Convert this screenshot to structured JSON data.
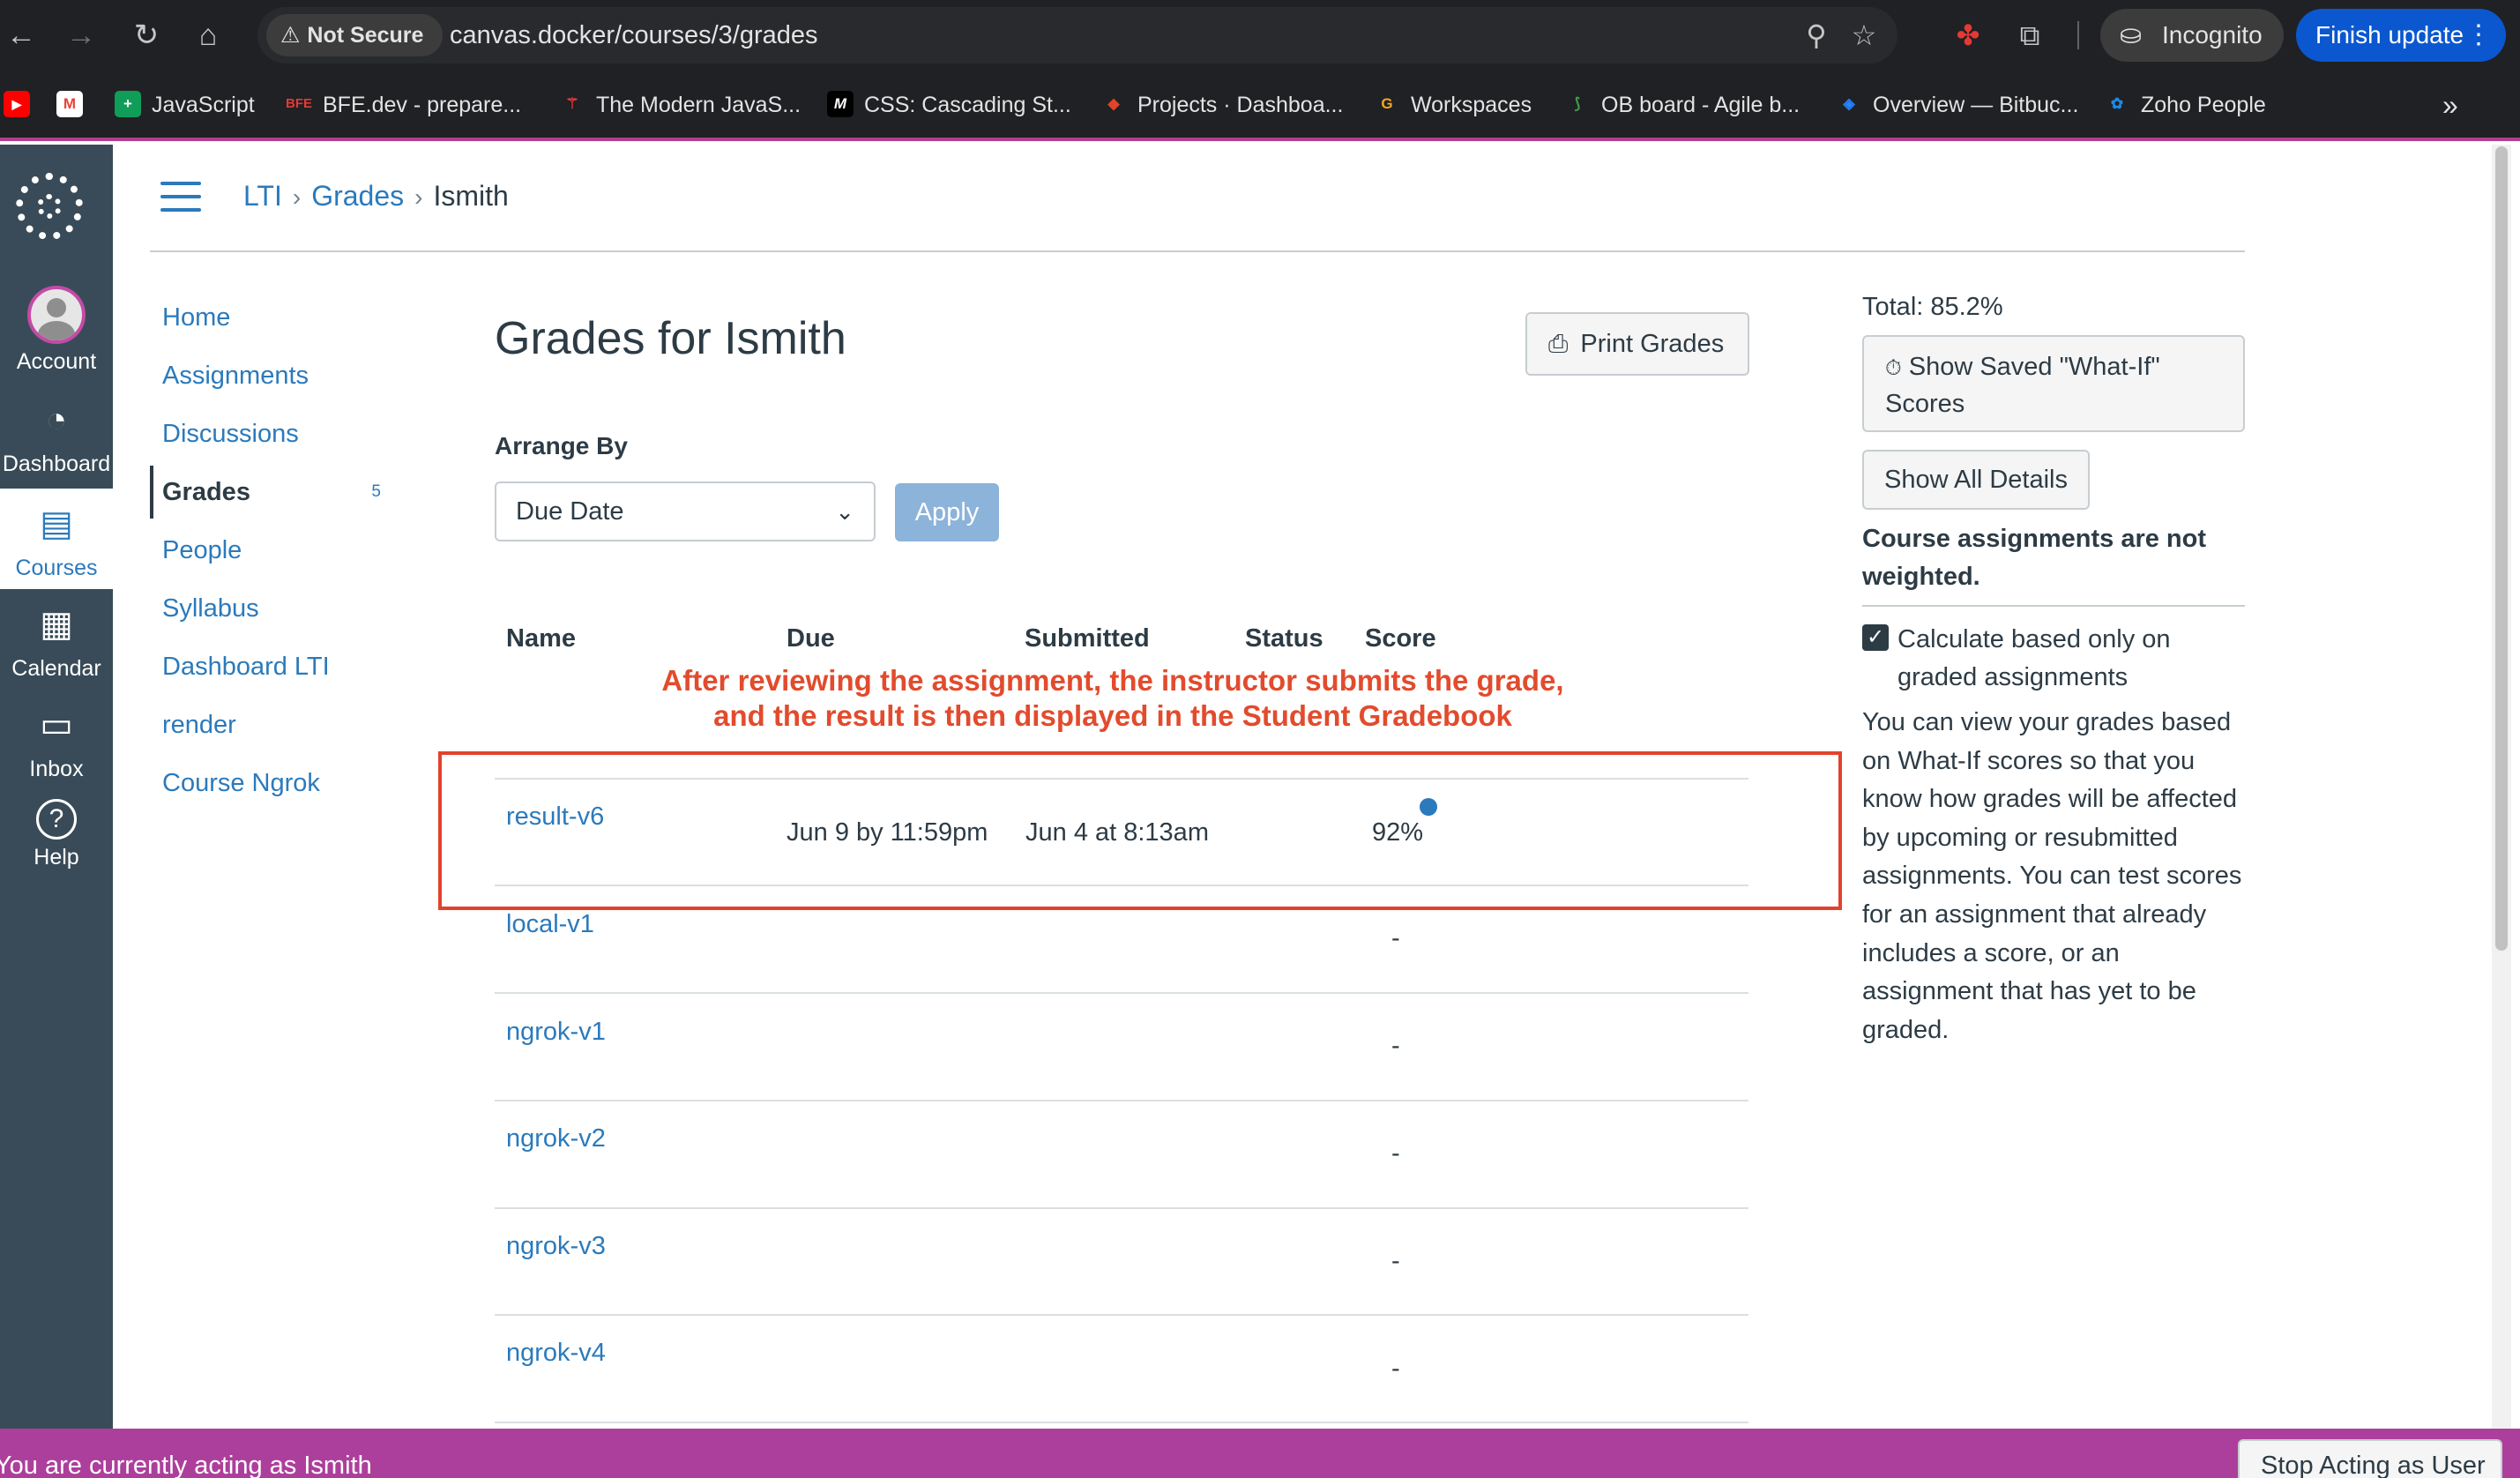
{
  "browser": {
    "security_label": "Not Secure",
    "url": "canvas.docker/courses/3/grades",
    "incognito_label": "Incognito",
    "update_label": "Finish update",
    "bookmarks": [
      {
        "label": "",
        "color": "#ff0000",
        "glyph": "▶"
      },
      {
        "label": "",
        "color": "#ffffff",
        "glyph": "M"
      },
      {
        "label": "JavaScript",
        "color": "#0f9d58",
        "glyph": "+"
      },
      {
        "label": "BFE.dev - prepare...",
        "color": "#202124",
        "glyph": "BFE"
      },
      {
        "label": "The Modern JavaS...",
        "color": "#202124",
        "glyph": "⚚"
      },
      {
        "label": "CSS: Cascading St...",
        "color": "#000000",
        "glyph": "M"
      },
      {
        "label": "Projects · Dashboa...",
        "color": "#e24329",
        "glyph": "◆"
      },
      {
        "label": "Workspaces",
        "color": "#f5a623",
        "glyph": "G"
      },
      {
        "label": "OB board - Agile b...",
        "color": "#2e7d32",
        "glyph": "⟆"
      },
      {
        "label": "Overview — Bitbuc...",
        "color": "#2684ff",
        "glyph": "◈"
      },
      {
        "label": "Zoho People",
        "color": "#1e88e5",
        "glyph": "✿"
      }
    ]
  },
  "global_nav": {
    "items": [
      {
        "label": "Account",
        "icon": "avatar-icon"
      },
      {
        "label": "Dashboard",
        "icon": "dashboard-icon"
      },
      {
        "label": "Courses",
        "icon": "courses-icon"
      },
      {
        "label": "Calendar",
        "icon": "calendar-icon"
      },
      {
        "label": "Inbox",
        "icon": "inbox-icon"
      },
      {
        "label": "Help",
        "icon": "help-icon"
      }
    ],
    "active_color": "#2b7abc"
  },
  "breadcrumb": {
    "items": [
      "LTI",
      "Grades",
      "Ismith"
    ]
  },
  "course_nav": {
    "items": [
      "Home",
      "Assignments",
      "Discussions",
      "Grades",
      "People",
      "Syllabus",
      "Dashboard LTI",
      "render",
      "Course Ngrok"
    ],
    "grades_badge": "5"
  },
  "main": {
    "title": "Grades for Ismith",
    "print_label": "Print Grades",
    "arrange_label": "Arrange By",
    "arrange_value": "Due Date",
    "apply_label": "Apply",
    "columns": [
      "Name",
      "Due",
      "Submitted",
      "Status",
      "Score"
    ],
    "rows": [
      {
        "name": "result-v6",
        "due": "Jun 9 by 11:59pm",
        "submitted": "Jun 4 at 8:13am",
        "status": "",
        "score": "92%"
      },
      {
        "name": "local-v1",
        "due": "",
        "submitted": "",
        "status": "",
        "score": "-"
      },
      {
        "name": "ngrok-v1",
        "due": "",
        "submitted": "",
        "status": "",
        "score": "-"
      },
      {
        "name": "ngrok-v2",
        "due": "",
        "submitted": "",
        "status": "",
        "score": "-"
      },
      {
        "name": "ngrok-v3",
        "due": "",
        "submitted": "",
        "status": "",
        "score": "-"
      },
      {
        "name": "ngrok-v4",
        "due": "",
        "submitted": "",
        "status": "",
        "score": "-"
      }
    ],
    "annotation_line1": "After reviewing the assignment, the instructor submits the grade,",
    "annotation_line2": "and the result is then displayed in the Student Gradebook",
    "annotation_color": "#e24b2d"
  },
  "sidebar": {
    "total": "Total: 85.2%",
    "whatif_label": "Show Saved \"What-If\" Scores",
    "show_all_label": "Show All Details",
    "weight_note": "Course assignments are not weighted.",
    "checkbox_label": "Calculate based only on graded assignments",
    "checkbox_checked": true,
    "description": "You can view your grades based on What-If scores so that you know how grades will be affected by upcoming or resubmitted assignments. You can test scores for an assignment that already includes a score, or an assignment that has yet to be graded."
  },
  "masquerade": {
    "text": "You are currently acting as Ismith",
    "stop_label": "Stop Acting as User",
    "bar_color": "#ad3f9c"
  }
}
